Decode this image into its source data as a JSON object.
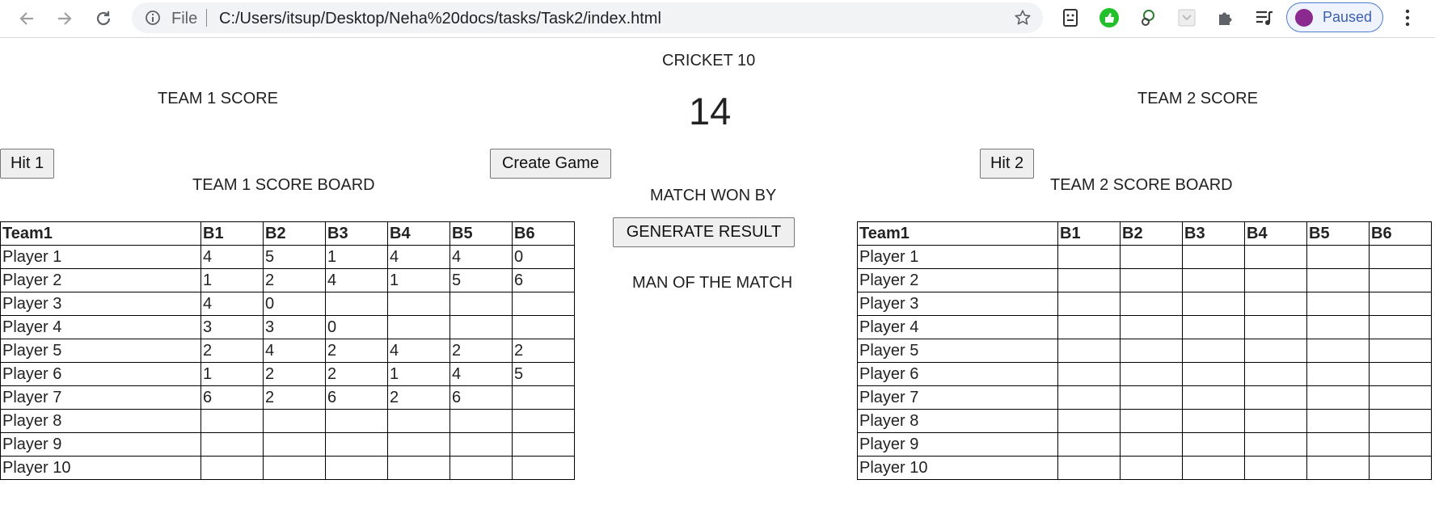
{
  "browser": {
    "scheme_label": "File",
    "url": "C:/Users/itsup/Desktop/Neha%20docs/tasks/Task2/index.html",
    "profile_status": "Paused",
    "accent_color": "#4f7bd0"
  },
  "page": {
    "title": "CRICKET 10",
    "timer": "14",
    "team1_score_label": "TEAM 1 SCORE",
    "team2_score_label": "TEAM 2 SCORE",
    "hit1_label": "Hit 1",
    "create_game_label": "Create Game",
    "hit2_label": "Hit 2",
    "team1_board_title": "TEAM 1 SCORE BOARD",
    "team2_board_title": "TEAM 2 SCORE BOARD",
    "match_won_by_label": "MATCH WON BY",
    "generate_result_label": "GENERATE RESULT",
    "man_of_match_label": "MAN OF THE MATCH"
  },
  "team1_table": {
    "headers": [
      "Team1",
      "B1",
      "B2",
      "B3",
      "B4",
      "B5",
      "B6"
    ],
    "rows": [
      [
        "Player 1",
        "4",
        "5",
        "1",
        "4",
        "4",
        "0"
      ],
      [
        "Player 2",
        "1",
        "2",
        "4",
        "1",
        "5",
        "6"
      ],
      [
        "Player 3",
        "4",
        "0",
        "",
        "",
        "",
        ""
      ],
      [
        "Player 4",
        "3",
        "3",
        "0",
        "",
        "",
        ""
      ],
      [
        "Player 5",
        "2",
        "4",
        "2",
        "4",
        "2",
        "2"
      ],
      [
        "Player 6",
        "1",
        "2",
        "2",
        "1",
        "4",
        "5"
      ],
      [
        "Player 7",
        "6",
        "2",
        "6",
        "2",
        "6",
        ""
      ],
      [
        "Player 8",
        "",
        "",
        "",
        "",
        "",
        ""
      ],
      [
        "Player 9",
        "",
        "",
        "",
        "",
        "",
        ""
      ],
      [
        "Player 10",
        "",
        "",
        "",
        "",
        "",
        ""
      ]
    ]
  },
  "team2_table": {
    "headers": [
      "Team1",
      "B1",
      "B2",
      "B3",
      "B4",
      "B5",
      "B6"
    ],
    "rows": [
      [
        "Player 1",
        "",
        "",
        "",
        "",
        "",
        ""
      ],
      [
        "Player 2",
        "",
        "",
        "",
        "",
        "",
        ""
      ],
      [
        "Player 3",
        "",
        "",
        "",
        "",
        "",
        ""
      ],
      [
        "Player 4",
        "",
        "",
        "",
        "",
        "",
        ""
      ],
      [
        "Player 5",
        "",
        "",
        "",
        "",
        "",
        ""
      ],
      [
        "Player 6",
        "",
        "",
        "",
        "",
        "",
        ""
      ],
      [
        "Player 7",
        "",
        "",
        "",
        "",
        "",
        ""
      ],
      [
        "Player 8",
        "",
        "",
        "",
        "",
        "",
        ""
      ],
      [
        "Player 9",
        "",
        "",
        "",
        "",
        "",
        ""
      ],
      [
        "Player 10",
        "",
        "",
        "",
        "",
        "",
        ""
      ]
    ]
  }
}
